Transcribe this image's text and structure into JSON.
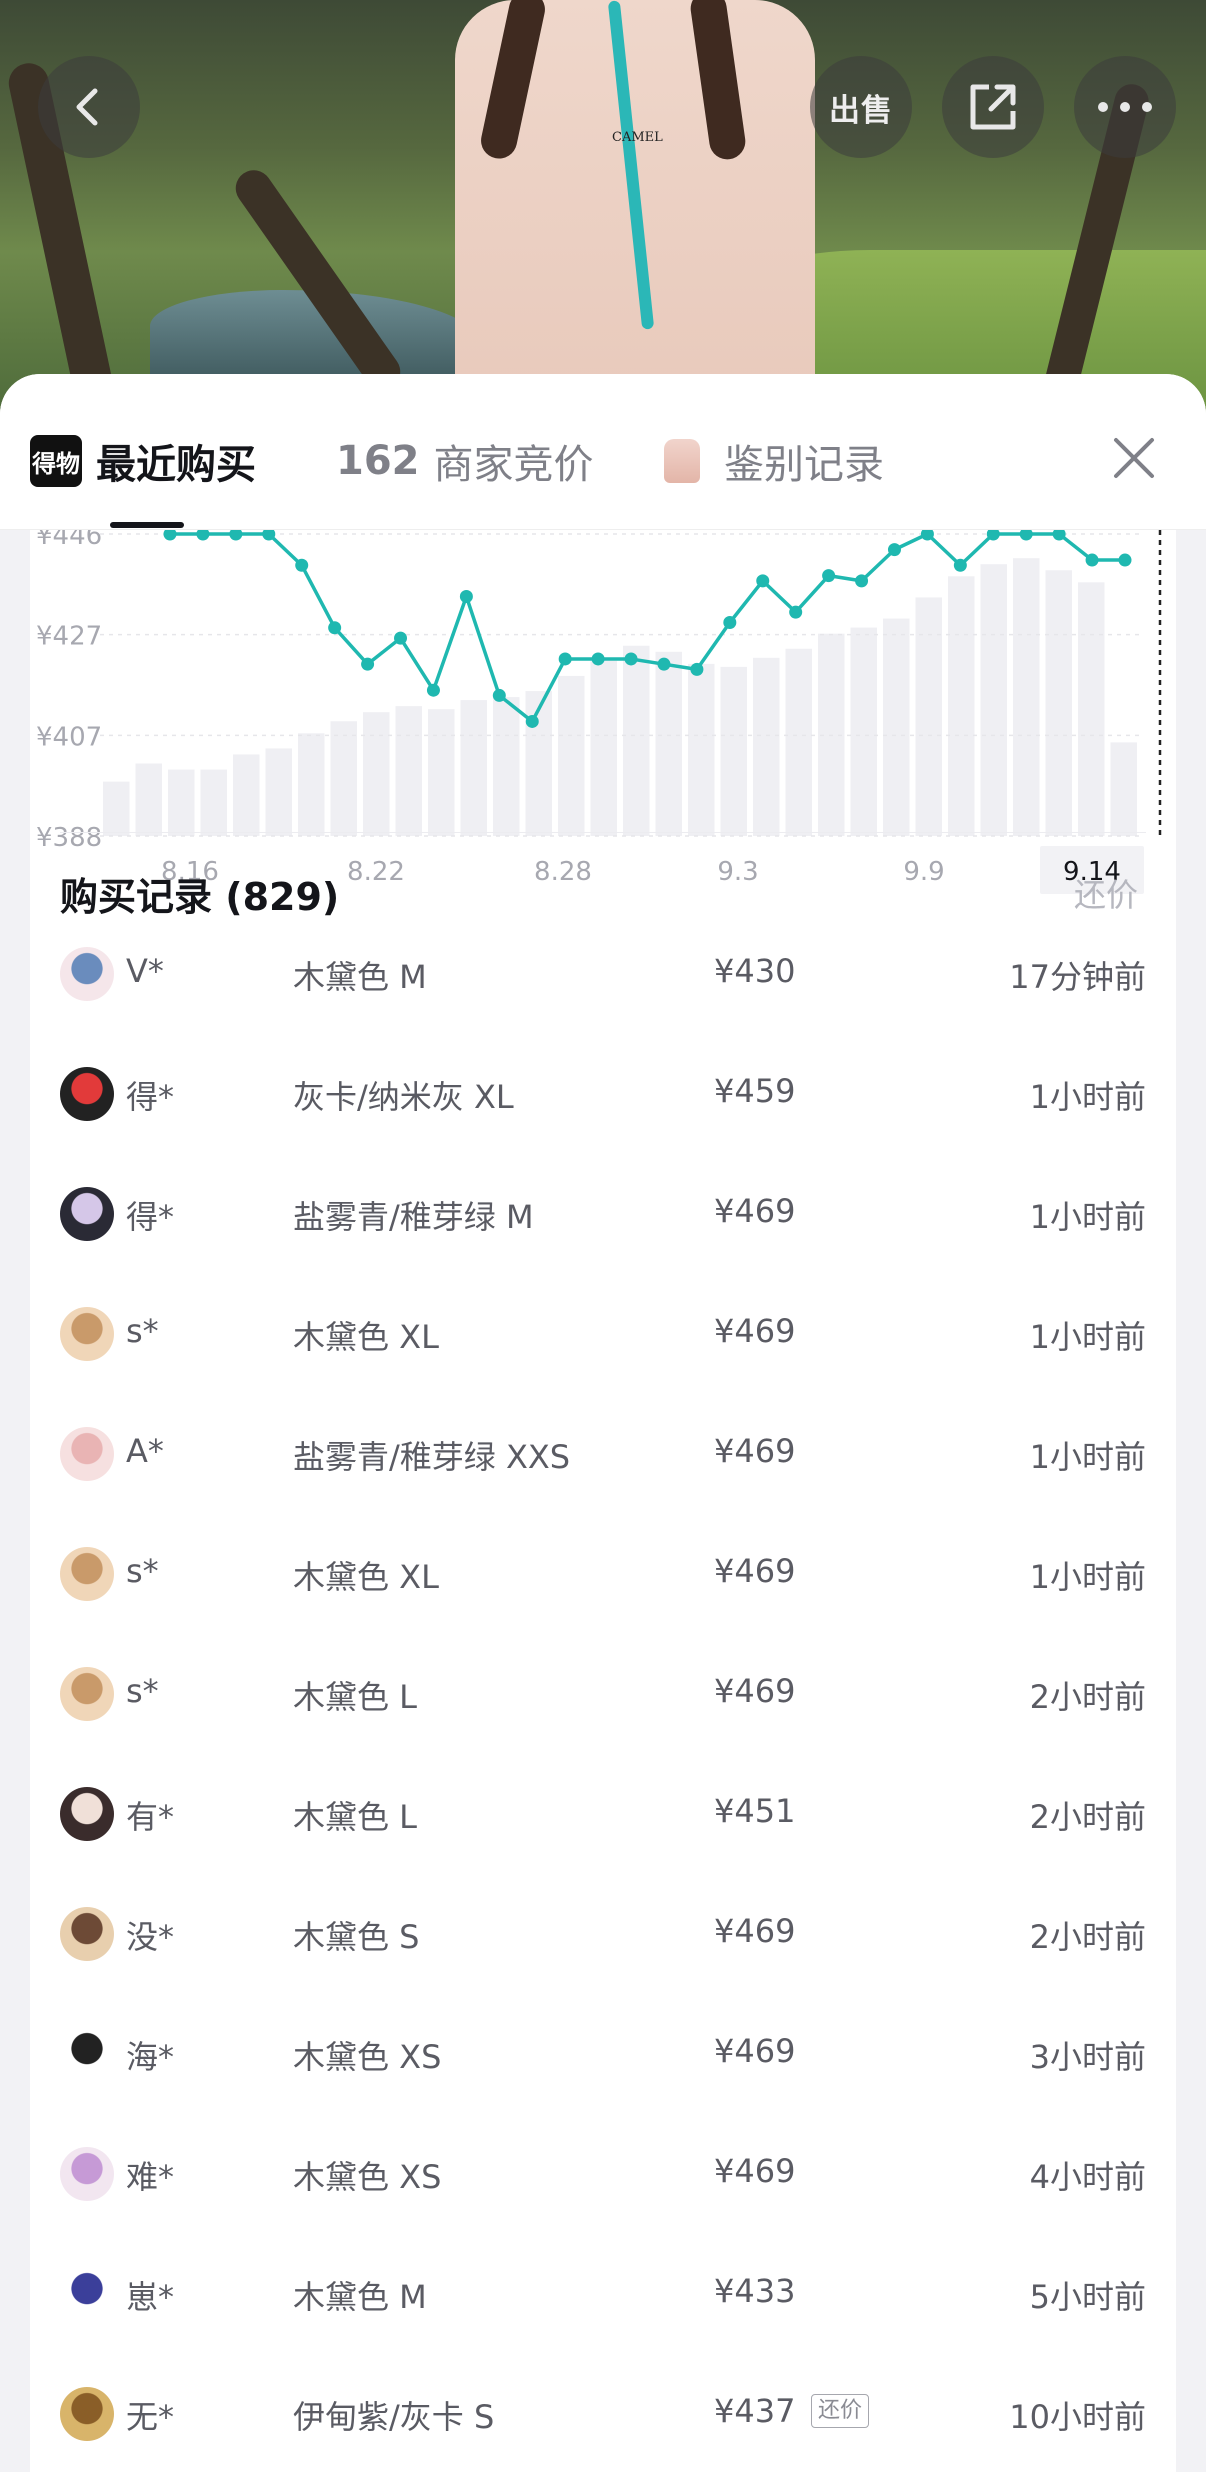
{
  "header": {
    "back_icon": "chevron-left-icon",
    "sell_label": "出售",
    "share_icon": "share-icon",
    "more_icon": "more-icon"
  },
  "product_photo": {
    "logo_text": "CAMEL"
  },
  "tabs": {
    "brand_badge": "得物",
    "recent_purchase": "最近购买",
    "bidding_count": "162",
    "bidding_label": "商家竞价",
    "authentication_label": "鉴别记录",
    "close_icon": "close-icon"
  },
  "chart_data": {
    "type": "line",
    "x_tick_labels": [
      "8.16",
      "8.22",
      "8.28",
      "9.3",
      "9.9",
      "9.14"
    ],
    "y_tick_labels": [
      "¥446",
      "¥427",
      "¥407",
      "¥388"
    ],
    "ylim": [
      388,
      446
    ],
    "selected_x": "9.14",
    "series": [
      {
        "values": [
          446,
          446,
          446,
          446,
          440,
          428,
          421,
          426,
          416,
          434,
          415,
          410,
          422,
          422,
          422,
          421,
          420,
          429,
          437,
          431,
          438,
          437,
          443,
          446,
          440,
          446,
          446,
          446,
          441,
          441
        ]
      }
    ],
    "bars": [
      0.18,
      0.24,
      0.22,
      0.22,
      0.27,
      0.29,
      0.34,
      0.38,
      0.41,
      0.43,
      0.42,
      0.45,
      0.46,
      0.48,
      0.53,
      0.58,
      0.63,
      0.61,
      0.57,
      0.56,
      0.59,
      0.62,
      0.67,
      0.69,
      0.72,
      0.79,
      0.86,
      0.9,
      0.92,
      0.88,
      0.84,
      0.31
    ]
  },
  "records": {
    "title": "购买记录 (829)",
    "action": "还价",
    "rows": [
      {
        "user": "V*",
        "variant": "木黛色 M",
        "price": "¥430",
        "time": "17分钟前"
      },
      {
        "user": "得*",
        "variant": "灰卡/纳米灰 XL",
        "price": "¥459",
        "time": "1小时前"
      },
      {
        "user": "得*",
        "variant": "盐雾青/稚芽绿 M",
        "price": "¥469",
        "time": "1小时前"
      },
      {
        "user": "s*",
        "variant": "木黛色 XL",
        "price": "¥469",
        "time": "1小时前"
      },
      {
        "user": "A*",
        "variant": "盐雾青/稚芽绿 XXS",
        "price": "¥469",
        "time": "1小时前"
      },
      {
        "user": "s*",
        "variant": "木黛色 XL",
        "price": "¥469",
        "time": "1小时前"
      },
      {
        "user": "s*",
        "variant": "木黛色 L",
        "price": "¥469",
        "time": "2小时前"
      },
      {
        "user": "有*",
        "variant": "木黛色 L",
        "price": "¥451",
        "time": "2小时前"
      },
      {
        "user": "没*",
        "variant": "木黛色 S",
        "price": "¥469",
        "time": "2小时前"
      },
      {
        "user": "海*",
        "variant": "木黛色 XS",
        "price": "¥469",
        "time": "3小时前"
      },
      {
        "user": "难*",
        "variant": "木黛色 XS",
        "price": "¥469",
        "time": "4小时前"
      },
      {
        "user": "崽*",
        "variant": "木黛色 M",
        "price": "¥433",
        "time": "5小时前"
      },
      {
        "user": "无*",
        "variant": "伊甸紫/灰卡 S",
        "price": "¥437",
        "tag": "还价",
        "time": "10小时前"
      }
    ]
  },
  "colors": {
    "line": "#1fb8b0",
    "bar": "#efeff3",
    "text": "#14151a",
    "muted": "#7f8088"
  }
}
